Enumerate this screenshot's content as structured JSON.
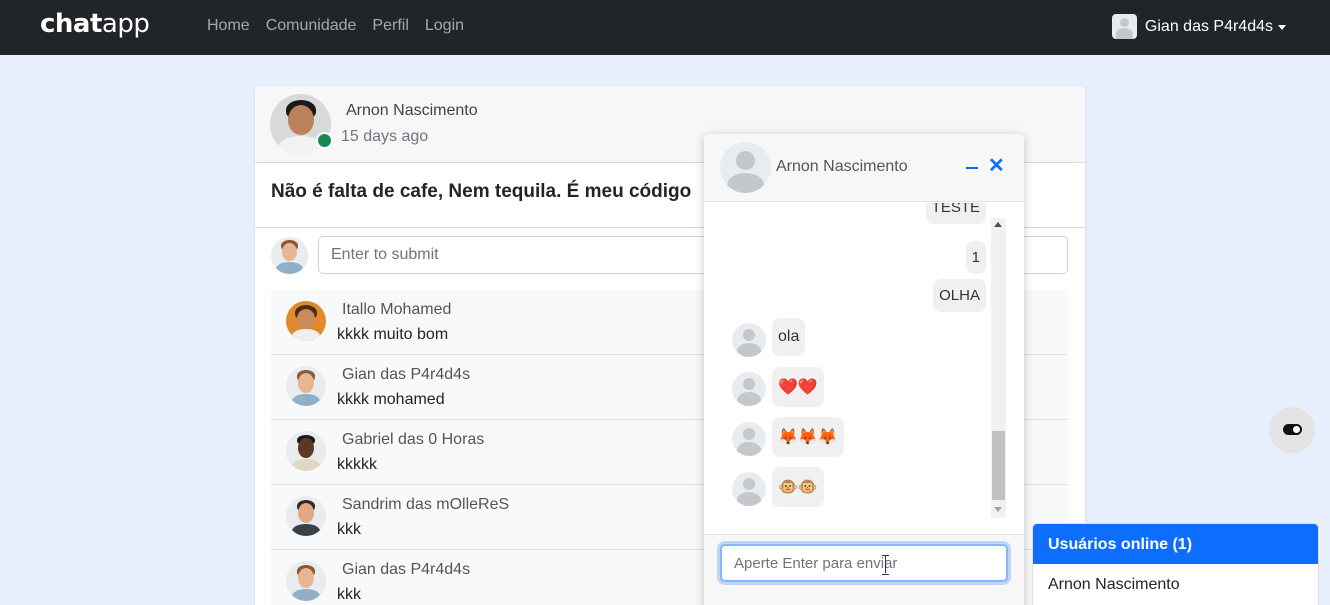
{
  "navbar": {
    "brand_bold": "chat",
    "brand_thin": "app",
    "links": [
      "Home",
      "Comunidade",
      "Perfil",
      "Login"
    ],
    "user_name": "Gian das P4r4d4s"
  },
  "post": {
    "author": "Arnon Nascimento",
    "time": "15 days ago",
    "body": "Não é falta de cafe, Nem tequila. É meu código",
    "comment_placeholder": "Enter to submit",
    "comments": [
      {
        "name": "Itallo Mohamed",
        "text": "kkkk muito bom"
      },
      {
        "name": "Gian das P4r4d4s",
        "text": "kkkk mohamed"
      },
      {
        "name": "Gabriel das 0 Horas",
        "text": "kkkkk"
      },
      {
        "name": "Sandrim das mOlleReS",
        "text": "kkk"
      },
      {
        "name": "Gian das P4r4d4s",
        "text": "kkk"
      }
    ]
  },
  "chat": {
    "title": "Arnon Nascimento",
    "outgoing": [
      "TESTE",
      "1",
      "OLHA"
    ],
    "incoming": [
      "ola",
      "❤️❤️",
      "🦊🦊🦊",
      "🐵🐵"
    ],
    "input_placeholder": "Aperte Enter para enviar"
  },
  "online": {
    "header": "Usuários online (1)",
    "users": [
      "Arnon Nascimento"
    ]
  },
  "colors": {
    "navbar": "#212529",
    "accent": "#0d6efd",
    "online_dot": "#198754",
    "page_bg": "#e7efff"
  }
}
